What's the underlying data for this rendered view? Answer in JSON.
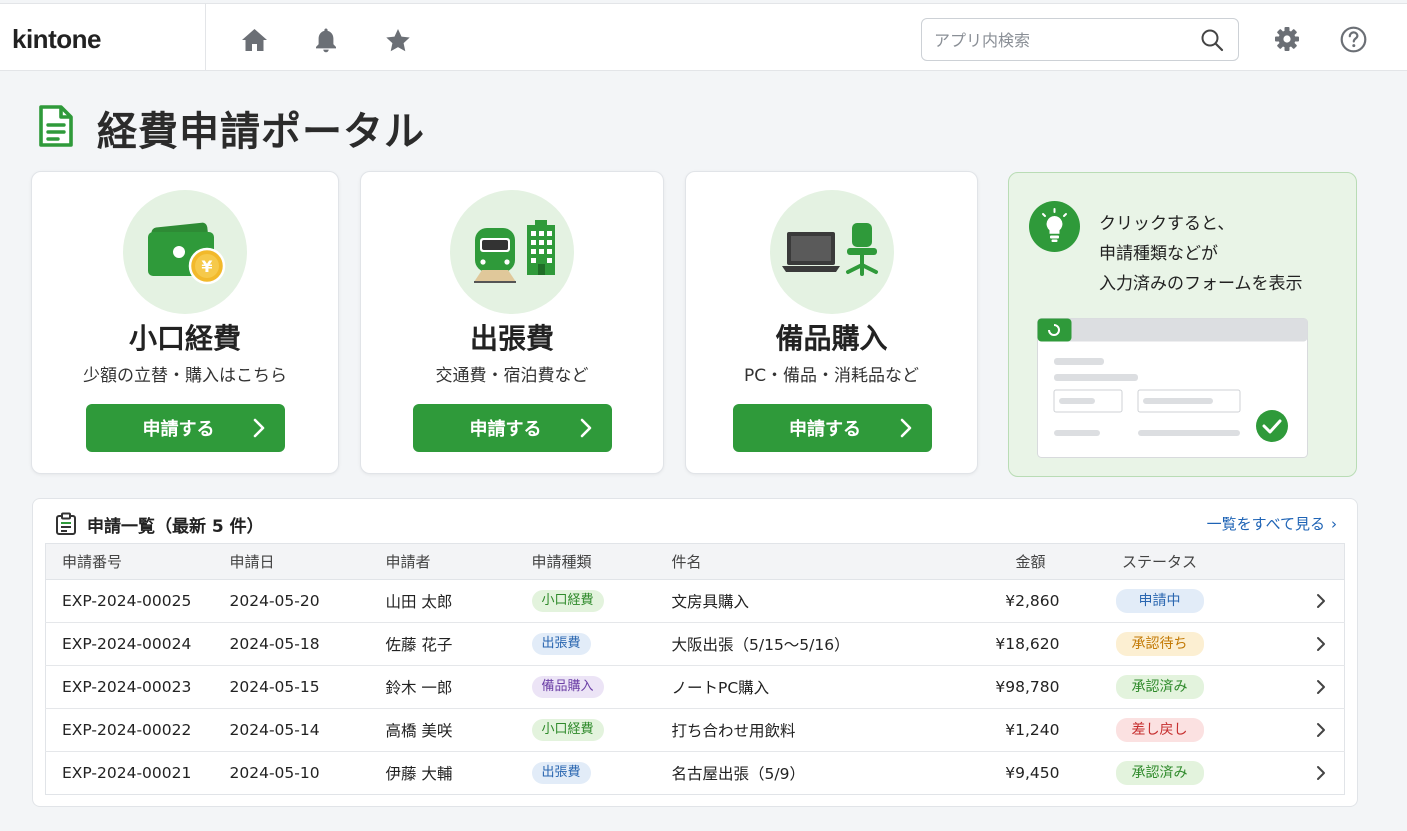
{
  "header": {
    "logo": "kintone",
    "search_placeholder": "アプリ内検索"
  },
  "page": {
    "title": "経費申請ポータル"
  },
  "cards": [
    {
      "title": "小口経費",
      "subtitle": "少額の立替・購入はこちら",
      "button": "申請する"
    },
    {
      "title": "出張費",
      "subtitle": "交通費・宿泊費など",
      "button": "申請する"
    },
    {
      "title": "備品購入",
      "subtitle": "PC・備品・消耗品など",
      "button": "申請する"
    }
  ],
  "hint": {
    "line1": "クリックすると、",
    "line2": "申請種類などが",
    "line3": "入力済みのフォームを表示"
  },
  "list": {
    "heading": "申請一覧（最新 5 件）",
    "view_all": "一覧をすべて見る",
    "columns": [
      "申請番号",
      "申請日",
      "申請者",
      "申請種類",
      "件名",
      "金額",
      "ステータス"
    ],
    "rows": [
      {
        "id": "EXP-2024-00025",
        "date": "2024-05-20",
        "applicant": "山田 太郎",
        "type": "小口経費",
        "subject": "文房具購入",
        "amount": "¥2,860",
        "status": "申請中"
      },
      {
        "id": "EXP-2024-00024",
        "date": "2024-05-18",
        "applicant": "佐藤 花子",
        "type": "出張費",
        "subject": "大阪出張（5/15〜5/16）",
        "amount": "¥18,620",
        "status": "承認待ち"
      },
      {
        "id": "EXP-2024-00023",
        "date": "2024-05-15",
        "applicant": "鈴木 一郎",
        "type": "備品購入",
        "subject": "ノートPC購入",
        "amount": "¥98,780",
        "status": "承認済み"
      },
      {
        "id": "EXP-2024-00022",
        "date": "2024-05-14",
        "applicant": "高橋 美咲",
        "type": "小口経費",
        "subject": "打ち合わせ用飲料",
        "amount": "¥1,240",
        "status": "差し戻し"
      },
      {
        "id": "EXP-2024-00021",
        "date": "2024-05-10",
        "applicant": "伊藤 大輔",
        "type": "出張費",
        "subject": "名古屋出張（5/9）",
        "amount": "¥9,450",
        "status": "承認済み"
      }
    ]
  },
  "colors": {
    "accent": "#2f9a3a",
    "link": "#1e63b5",
    "type_petty": {
      "bg": "#e3f3dd",
      "fg": "#2e8a2a"
    },
    "type_travel": {
      "bg": "#e2ecf8",
      "fg": "#2a66b0"
    },
    "type_equipment": {
      "bg": "#ece4f6",
      "fg": "#6b3fa6"
    },
    "status_applied": {
      "bg": "#e2ecf8",
      "fg": "#2a66b0"
    },
    "status_waiting": {
      "bg": "#fcefd2",
      "fg": "#c37a06"
    },
    "status_approved": {
      "bg": "#e3f3dd",
      "fg": "#2e8a2a"
    },
    "status_returned": {
      "bg": "#fbe1e1",
      "fg": "#c62e2e"
    }
  }
}
